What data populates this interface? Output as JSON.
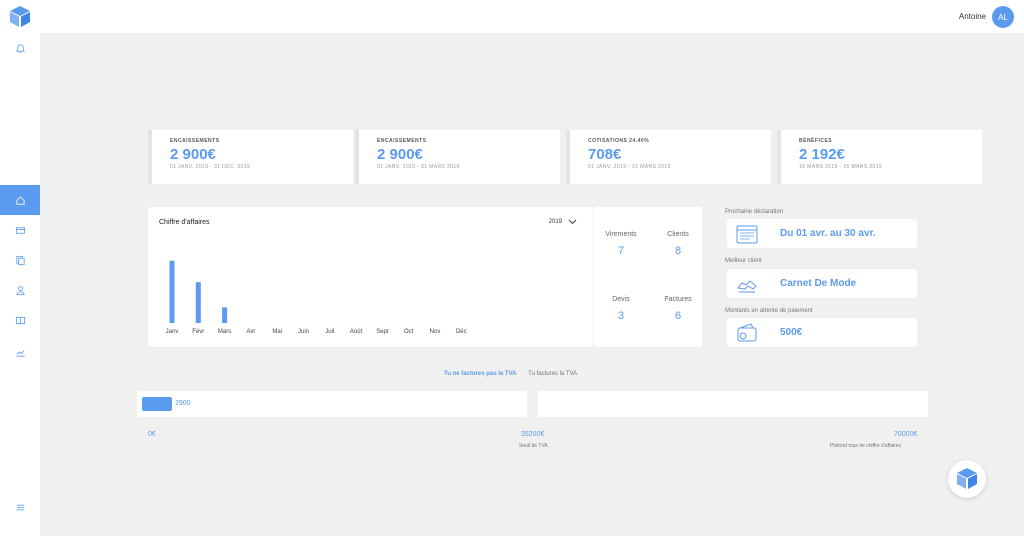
{
  "header": {
    "user_name": "Antoine",
    "avatar_initials": "AL"
  },
  "sidebar": {
    "items": [
      {
        "icon": "bell-icon"
      },
      {
        "icon": "home-icon",
        "active": true
      },
      {
        "icon": "card-icon"
      },
      {
        "icon": "documents-icon"
      },
      {
        "icon": "user-icon"
      },
      {
        "icon": "book-icon"
      },
      {
        "icon": "trend-icon"
      },
      {
        "icon": "menu-icon"
      }
    ]
  },
  "stats": [
    {
      "label": "ENCAISSEMENTS",
      "value": "2 900€",
      "date": "01 JANV. 2019 - 31 DÉC. 2019"
    },
    {
      "label": "ENCAISSEMENTS",
      "value": "2 900€",
      "date": "01 JANV. 2019 - 31 MARS 2019"
    },
    {
      "label": "COTISATIONS 24.40%",
      "value": "708€",
      "date": "01 JANV. 2019 - 31 MARS 2019"
    },
    {
      "label": "BÉNÉFICES",
      "value": "2 192€",
      "date": "16 MARS 2019 - 16 MARS 2019"
    }
  ],
  "chart": {
    "title": "Chiffre d'affaires",
    "year": "2019"
  },
  "chart_data": {
    "type": "bar",
    "categories": [
      "Janv",
      "Févr",
      "Mars",
      "Avr",
      "Mai",
      "Juin",
      "Juil",
      "Août",
      "Sept",
      "Oct",
      "Nov",
      "Déc"
    ],
    "values": [
      1600,
      1050,
      400,
      0,
      0,
      0,
      0,
      0,
      0,
      0,
      0,
      0
    ],
    "ylim": [
      0,
      1800
    ],
    "grid": false,
    "color": "#5b9bef"
  },
  "kpis": [
    {
      "label": "Virements",
      "value": "7"
    },
    {
      "label": "Clients",
      "value": "8"
    },
    {
      "label": "Devis",
      "value": "3"
    },
    {
      "label": "Factures",
      "value": "6"
    }
  ],
  "right_panel": {
    "declaration": {
      "label": "Prochaine déclaration",
      "value": "Du 01 avr. au 30 avr."
    },
    "client": {
      "label": "Meilleur client",
      "value": "Carnet De Mode"
    },
    "pending": {
      "label": "Montants en attente de paiement",
      "value": "500€"
    }
  },
  "tva": {
    "tabs": [
      "Tu ne factures pas la TVA",
      "Tu factures la TVA"
    ],
    "current": "2900",
    "scale": [
      {
        "value": "0€",
        "label": ""
      },
      {
        "value": "35200€",
        "label": "Seuil de TVA"
      },
      {
        "value": "70000€",
        "label": "Plafond max de chiffre d'affaires"
      }
    ]
  },
  "colors": {
    "accent": "#5b9bef",
    "background": "#f0f0f0"
  }
}
